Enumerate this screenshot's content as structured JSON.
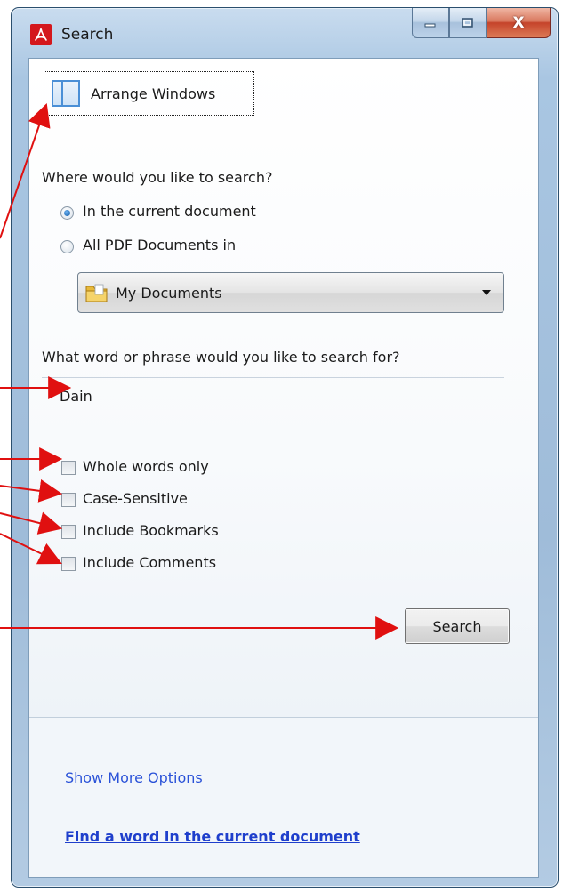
{
  "window": {
    "title": "Search",
    "minimize_label": "minimize",
    "maximize_label": "maximize",
    "close_glyph": "X"
  },
  "arrange": {
    "label": "Arrange Windows",
    "icon": "window-layout-icon"
  },
  "scope": {
    "question": "Where would you like to search?",
    "options": [
      {
        "label": "In the current document",
        "checked": true
      },
      {
        "label": "All PDF Documents in",
        "checked": false
      }
    ],
    "folder": {
      "value": "My Documents",
      "icon": "folder-icon"
    }
  },
  "phrase": {
    "question": "What word or phrase would you like to search for?",
    "value": "Dain"
  },
  "options": [
    {
      "label": "Whole words only",
      "checked": false
    },
    {
      "label": "Case-Sensitive",
      "checked": false
    },
    {
      "label": "Include Bookmarks",
      "checked": false
    },
    {
      "label": "Include Comments",
      "checked": false
    }
  ],
  "search_button": {
    "label": "Search"
  },
  "footer": {
    "more_options": "Show More Options",
    "find_word": "Find a word in the current document"
  },
  "colors": {
    "link": "#2a52d8",
    "arrow": "#e01010",
    "title_logo": "#d4171c"
  }
}
